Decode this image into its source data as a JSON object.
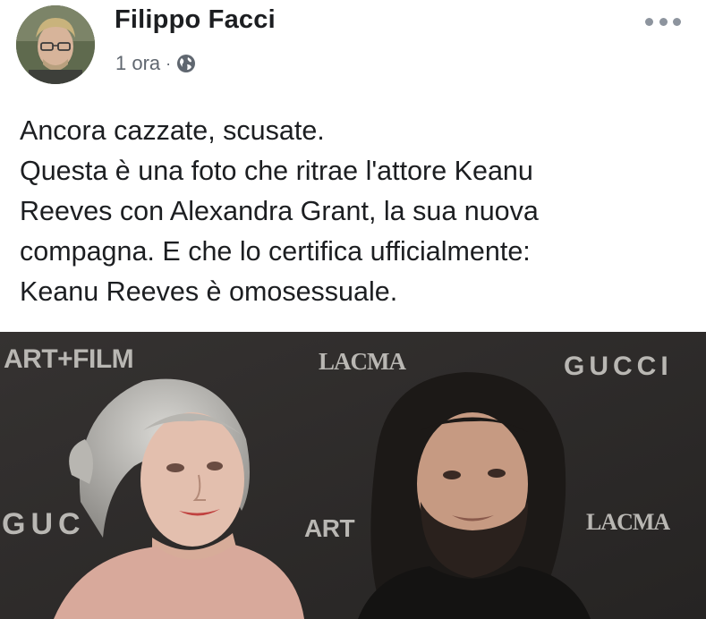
{
  "post": {
    "author": "Filippo Facci",
    "timestamp": "1 ora",
    "separator": "·",
    "privacy_icon": "globe-icon",
    "more_icon": "more-options-icon",
    "text_lines": [
      "Ancora cazzate, scusate.",
      "Questa è una foto che ritrae l'attore Keanu",
      "Reeves con Alexandra Grant, la sua nuova",
      "compagna. E che lo certifica ufficialmente:",
      "Keanu Reeves è omosessuale."
    ]
  },
  "photo": {
    "backdrop_logos": {
      "artfilm_top": "ART+FILM",
      "lacma_top": "LACMA",
      "gucci_top": "GUCCI",
      "gucci_bottom": "GUC",
      "artfilm_bottom": "ART",
      "lacma_bottom": "LACMA"
    }
  },
  "colors": {
    "text": "#1c1e21",
    "meta": "#606770",
    "icon_gray": "#8d949e",
    "backdrop": "#2e2c2b"
  }
}
